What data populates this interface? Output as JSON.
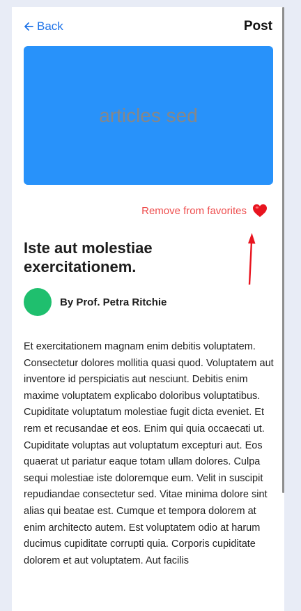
{
  "header": {
    "back_label": "Back",
    "title": "Post"
  },
  "hero": {
    "text": "articles sed",
    "color": "#2892fa"
  },
  "favorite": {
    "label": "Remove from favorites",
    "icon": "heart-icon",
    "color": "#ee4c4c"
  },
  "article": {
    "title": "Iste aut molestiae exercitationem.",
    "author": "By Prof. Petra Ritchie",
    "avatar_color": "#1fbf6e",
    "body": "Et exercitationem magnam enim debitis voluptatem. Consectetur dolores mollitia quasi quod. Voluptatem aut inventore id perspiciatis aut nesciunt. Debitis enim maxime voluptatem explicabo doloribus voluptatibus. Cupiditate voluptatum molestiae fugit dicta eveniet. Et rem et recusandae et eos. Enim qui quia occaecati ut. Cupiditate voluptas aut voluptatum excepturi aut. Eos quaerat ut pariatur eaque totam ullam dolores. Culpa sequi molestiae iste doloremque eum. Velit in suscipit repudiandae consectetur sed. Vitae minima dolore sint alias qui beatae est. Cumque et tempora dolorem at enim architecto autem. Est voluptatem odio at harum ducimus cupiditate corrupti quia. Corporis cupiditate dolorem et aut voluptatem. Aut facilis"
  }
}
